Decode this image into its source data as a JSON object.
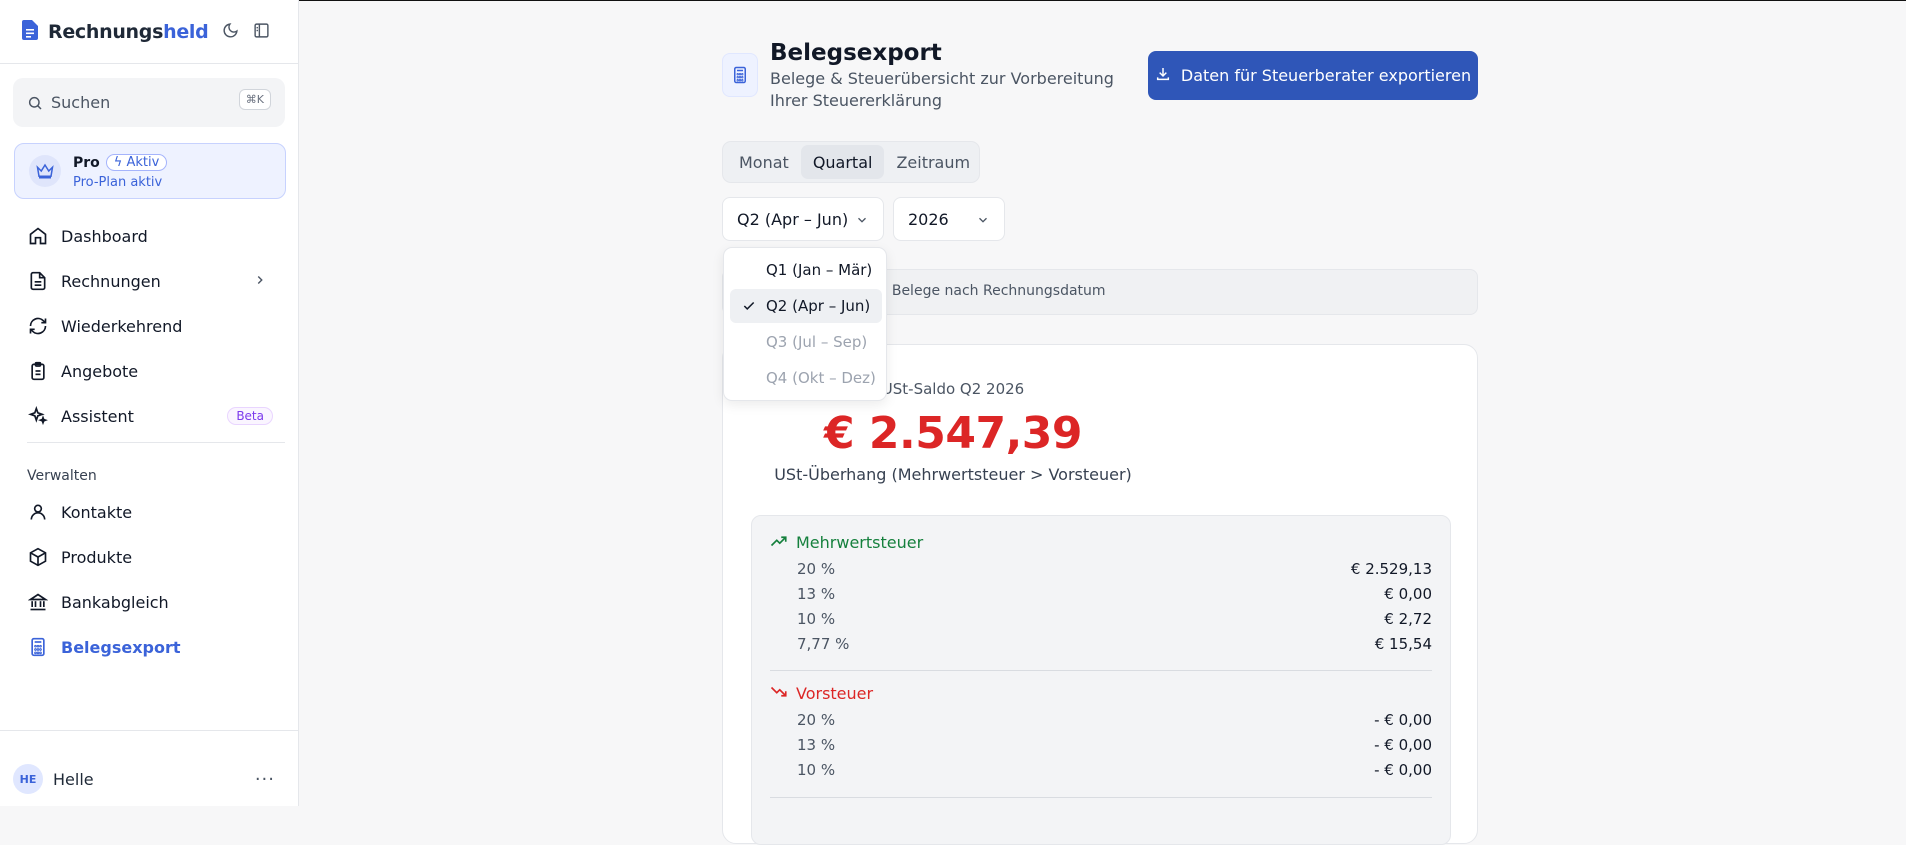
{
  "app": {
    "name_part1": "Rechnungs",
    "name_part2": "held"
  },
  "search": {
    "placeholder": "Suchen",
    "shortcut": "⌘K"
  },
  "plan": {
    "name": "Pro",
    "badge": "Aktiv",
    "status": "Pro-Plan aktiv"
  },
  "nav": [
    {
      "label": "Dashboard",
      "icon": "home-icon"
    },
    {
      "label": "Rechnungen",
      "icon": "document-icon"
    },
    {
      "label": "Wiederkehrend",
      "icon": "refresh-icon"
    },
    {
      "label": "Angebote",
      "icon": "clipboard-icon"
    },
    {
      "label": "Assistent",
      "icon": "sparkles-icon",
      "badge": "Beta"
    }
  ],
  "manage": {
    "label": "Verwalten",
    "items": [
      {
        "label": "Kontakte",
        "icon": "user-icon"
      },
      {
        "label": "Produkte",
        "icon": "box-icon"
      },
      {
        "label": "Bankabgleich",
        "icon": "bank-icon"
      },
      {
        "label": "Belegsexport",
        "icon": "calculator-icon",
        "active": true
      }
    ]
  },
  "user": {
    "initials": "HE",
    "name": "Helle"
  },
  "page": {
    "title": "Belegsexport",
    "subtitle": "Belege & Steuerübersicht zur Vorbereitung Ihrer Steuererklärung",
    "export_label": "Daten für Steuerberater exportieren"
  },
  "tabs": [
    {
      "label": "Monat"
    },
    {
      "label": "Quartal",
      "active": true
    },
    {
      "label": "Zeitraum"
    }
  ],
  "selects": {
    "quarter": "Q2 (Apr – Jun)",
    "year": "2026"
  },
  "quarter_options": [
    {
      "label": "Q1 (Jan – Mär)"
    },
    {
      "label": "Q2 (Apr – Jun)",
      "selected": true
    },
    {
      "label": "Q3 (Jul – Sep)",
      "disabled": true
    },
    {
      "label": "Q4 (Okt – Dez)",
      "disabled": true
    }
  ],
  "info": "lle Belege nach Rechnungsdatum",
  "summary": {
    "label": "USt-Saldo Q2 2026",
    "value": "€ 2.547,39",
    "description": "USt-Überhang (Mehrwertsteuer > Vorsteuer)"
  },
  "mwst": {
    "title": "Mehrwertsteuer",
    "rows": [
      {
        "rate": "20 %",
        "value": "€ 2.529,13"
      },
      {
        "rate": "13 %",
        "value": "€ 0,00"
      },
      {
        "rate": "10 %",
        "value": "€ 2,72"
      },
      {
        "rate": "7,77 %",
        "value": "€ 15,54"
      }
    ]
  },
  "vorsteuer": {
    "title": "Vorsteuer",
    "rows": [
      {
        "rate": "20 %",
        "value": "- € 0,00"
      },
      {
        "rate": "13 %",
        "value": "- € 0,00"
      },
      {
        "rate": "10 %",
        "value": "- € 0,00"
      }
    ]
  },
  "colors": {
    "accent": "#3b63d9",
    "button": "#2f56b8",
    "negative": "#dc2626",
    "positive": "#15803d"
  }
}
